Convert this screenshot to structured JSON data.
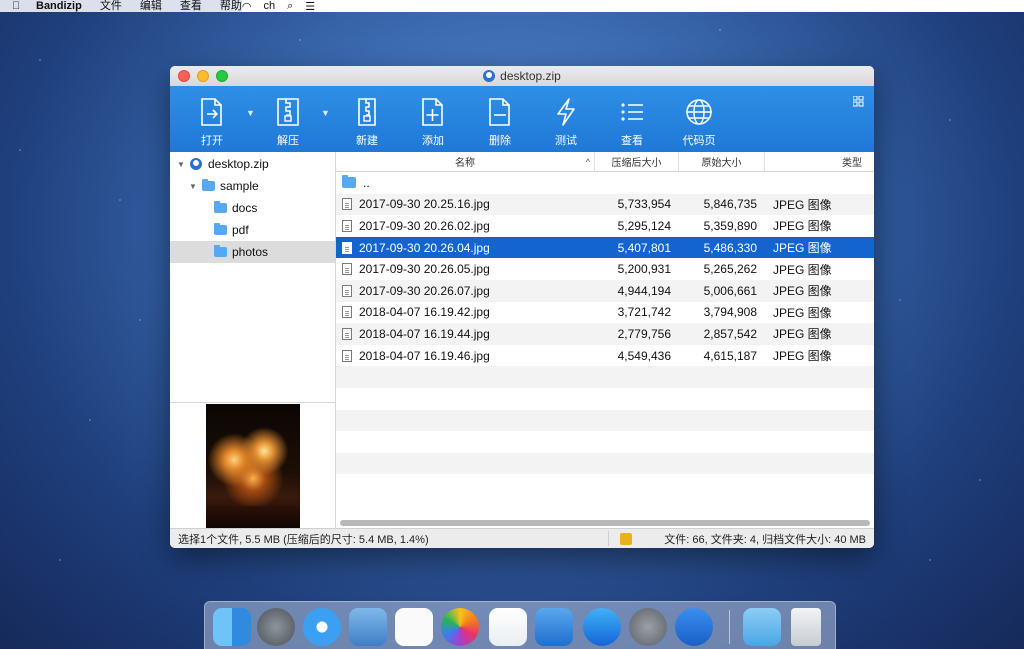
{
  "menubar": {
    "app_name": "Bandizip",
    "items": [
      "文件",
      "编辑",
      "查看",
      "帮助"
    ],
    "input_method": "ch"
  },
  "window": {
    "title": "desktop.zip"
  },
  "toolbar": {
    "buttons": [
      {
        "label": "打开",
        "icon": "open-icon"
      },
      {
        "label": "解压",
        "icon": "extract-icon"
      },
      {
        "label": "新建",
        "icon": "new-archive-icon"
      },
      {
        "label": "添加",
        "icon": "add-icon"
      },
      {
        "label": "删除",
        "icon": "delete-icon"
      },
      {
        "label": "测试",
        "icon": "test-icon"
      },
      {
        "label": "查看",
        "icon": "view-icon"
      },
      {
        "label": "代码页",
        "icon": "codepage-icon"
      }
    ]
  },
  "tree": {
    "items": [
      {
        "label": "desktop.zip",
        "level": 0,
        "expanded": true,
        "type": "zip"
      },
      {
        "label": "sample",
        "level": 1,
        "expanded": true,
        "type": "folder"
      },
      {
        "label": "docs",
        "level": 2,
        "type": "folder"
      },
      {
        "label": "pdf",
        "level": 2,
        "type": "folder"
      },
      {
        "label": "photos",
        "level": 2,
        "type": "folder",
        "selected": true
      }
    ]
  },
  "file_list": {
    "columns": {
      "name": "名称",
      "compressed": "压缩后大小",
      "original": "原始大小",
      "type": "类型"
    },
    "parent_row": "..",
    "rows": [
      {
        "name": "2017-09-30 20.25.16.jpg",
        "compressed": "5,733,954",
        "original": "5,846,735",
        "type": "JPEG 图像"
      },
      {
        "name": "2017-09-30 20.26.02.jpg",
        "compressed": "5,295,124",
        "original": "5,359,890",
        "type": "JPEG 图像"
      },
      {
        "name": "2017-09-30 20.26.04.jpg",
        "compressed": "5,407,801",
        "original": "5,486,330",
        "type": "JPEG 图像",
        "selected": true
      },
      {
        "name": "2017-09-30 20.26.05.jpg",
        "compressed": "5,200,931",
        "original": "5,265,262",
        "type": "JPEG 图像"
      },
      {
        "name": "2017-09-30 20.26.07.jpg",
        "compressed": "4,944,194",
        "original": "5,006,661",
        "type": "JPEG 图像"
      },
      {
        "name": "2018-04-07 16.19.42.jpg",
        "compressed": "3,721,742",
        "original": "3,794,908",
        "type": "JPEG 图像"
      },
      {
        "name": "2018-04-07 16.19.44.jpg",
        "compressed": "2,779,756",
        "original": "2,857,542",
        "type": "JPEG 图像"
      },
      {
        "name": "2018-04-07 16.19.46.jpg",
        "compressed": "4,549,436",
        "original": "4,615,187",
        "type": "JPEG 图像"
      }
    ]
  },
  "status": {
    "left": "选择1个文件, 5.5 MB (压缩后的尺寸: 5.4 MB, 1.4%)",
    "right": "文件: 66, 文件夹: 4, 归档文件大小: 40 MB"
  },
  "dock": {
    "icons": [
      "finder-icon",
      "launchpad-icon",
      "safari-icon",
      "mail-icon",
      "reminders-icon",
      "photos-icon",
      "numbers-icon",
      "keynote-icon",
      "app-store-icon",
      "system-preferences-icon",
      "bandizip-icon",
      "downloads-folder-icon",
      "trash-icon"
    ]
  },
  "colors": {
    "toolbar": "#2383de",
    "selection": "#1464d0",
    "folder": "#56a8f0"
  }
}
